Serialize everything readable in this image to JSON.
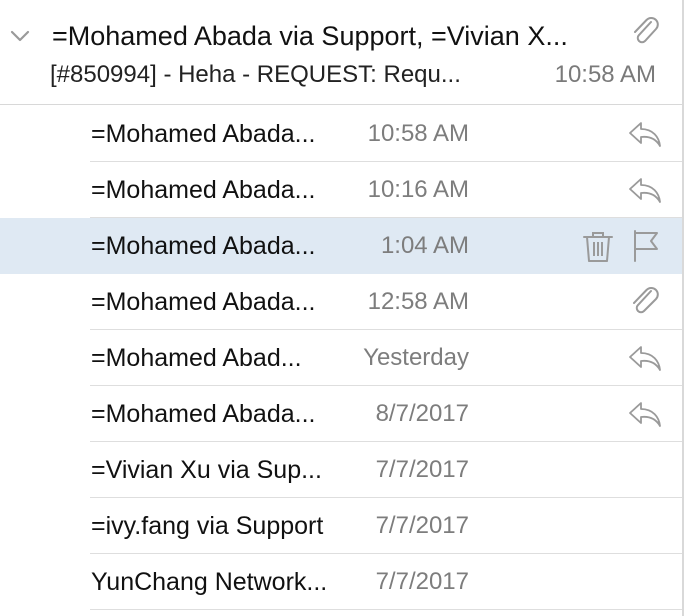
{
  "thread": {
    "subject": "=Mohamed Abada via Support, =Vivian X...",
    "preview": "[#850994] - Heha - REQUEST: Requ...",
    "time": "10:58 AM",
    "has_attachment": true
  },
  "messages": [
    {
      "sender": "=Mohamed Abada...",
      "time": "10:58 AM",
      "icon": "reply-icon"
    },
    {
      "sender": "=Mohamed Abada...",
      "time": "10:16 AM",
      "icon": "reply-icon"
    },
    {
      "sender": "=Mohamed Abada...",
      "time": "1:04 AM",
      "icon": "trash-and-flag",
      "selected": true
    },
    {
      "sender": "=Mohamed Abada...",
      "time": "12:58 AM",
      "icon": "paperclip-icon"
    },
    {
      "sender": "=Mohamed Abad...",
      "time": "Yesterday",
      "icon": "reply-icon"
    },
    {
      "sender": "=Mohamed Abada...",
      "time": "8/7/2017",
      "icon": "reply-icon"
    },
    {
      "sender": "=Vivian Xu via Sup...",
      "time": "7/7/2017",
      "icon": ""
    },
    {
      "sender": "=ivy.fang via Support",
      "time": "7/7/2017",
      "icon": ""
    },
    {
      "sender": "YunChang Network...",
      "time": "7/7/2017",
      "icon": ""
    }
  ],
  "colors": {
    "selected_row": "#dfe9f3",
    "icon_gray": "#9a9a9a",
    "text": "#111111",
    "time_gray": "#7d7d7d"
  }
}
